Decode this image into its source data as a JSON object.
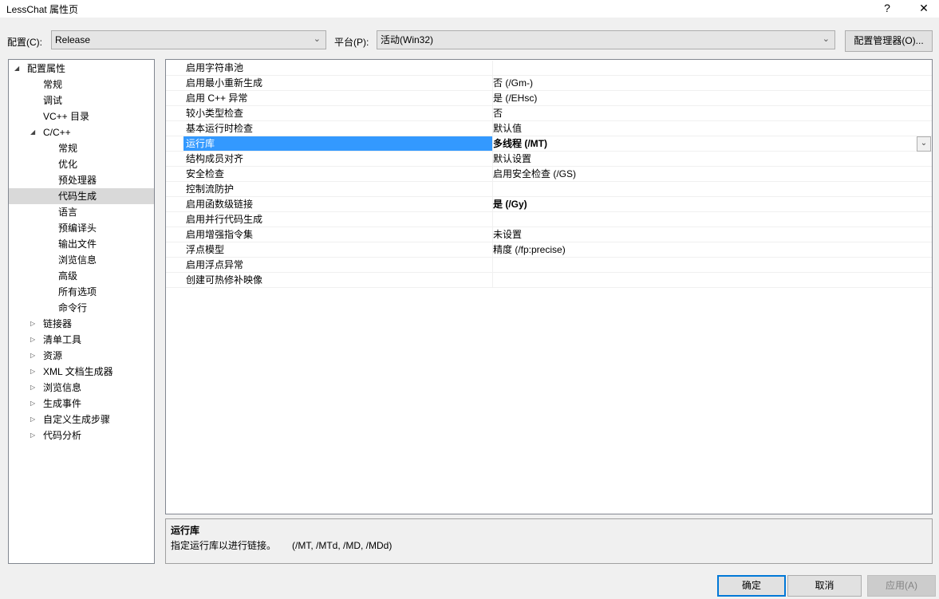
{
  "window": {
    "title": "LessChat 属性页",
    "help": "?",
    "close": "✕"
  },
  "config": {
    "label": "配置(C):",
    "value": "Release",
    "platform_label": "平台(P):",
    "platform_value": "活动(Win32)",
    "manager_button": "配置管理器(O)..."
  },
  "tree": [
    {
      "label": "配置属性",
      "level": 0,
      "expander": "expanded"
    },
    {
      "label": "常规",
      "level": 1
    },
    {
      "label": "调试",
      "level": 1
    },
    {
      "label": "VC++ 目录",
      "level": 1
    },
    {
      "label": "C/C++",
      "level": 1,
      "expander": "expanded"
    },
    {
      "label": "常规",
      "level": 2
    },
    {
      "label": "优化",
      "level": 2
    },
    {
      "label": "预处理器",
      "level": 2
    },
    {
      "label": "代码生成",
      "level": 2,
      "selected": true
    },
    {
      "label": "语言",
      "level": 2
    },
    {
      "label": "预编译头",
      "level": 2
    },
    {
      "label": "输出文件",
      "level": 2
    },
    {
      "label": "浏览信息",
      "level": 2
    },
    {
      "label": "高级",
      "level": 2
    },
    {
      "label": "所有选项",
      "level": 2
    },
    {
      "label": "命令行",
      "level": 2
    },
    {
      "label": "链接器",
      "level": 1,
      "expander": "collapsed"
    },
    {
      "label": "清单工具",
      "level": 1,
      "expander": "collapsed"
    },
    {
      "label": "资源",
      "level": 1,
      "expander": "collapsed"
    },
    {
      "label": "XML 文档生成器",
      "level": 1,
      "expander": "collapsed"
    },
    {
      "label": "浏览信息",
      "level": 1,
      "expander": "collapsed"
    },
    {
      "label": "生成事件",
      "level": 1,
      "expander": "collapsed"
    },
    {
      "label": "自定义生成步骤",
      "level": 1,
      "expander": "collapsed"
    },
    {
      "label": "代码分析",
      "level": 1,
      "expander": "collapsed"
    }
  ],
  "properties": [
    {
      "name": "启用字符串池",
      "value": ""
    },
    {
      "name": "启用最小重新生成",
      "value": "否 (/Gm-)"
    },
    {
      "name": "启用 C++ 异常",
      "value": "是 (/EHsc)"
    },
    {
      "name": "较小类型检查",
      "value": "否"
    },
    {
      "name": "基本运行时检查",
      "value": "默认值"
    },
    {
      "name": "运行库",
      "value": "多线程 (/MT)",
      "bold": true,
      "selected": true
    },
    {
      "name": "结构成员对齐",
      "value": "默认设置"
    },
    {
      "name": "安全检查",
      "value": "启用安全检查 (/GS)"
    },
    {
      "name": "控制流防护",
      "value": ""
    },
    {
      "name": "启用函数级链接",
      "value": "是 (/Gy)",
      "bold": true
    },
    {
      "name": "启用并行代码生成",
      "value": ""
    },
    {
      "name": "启用增强指令集",
      "value": "未设置"
    },
    {
      "name": "浮点模型",
      "value": "精度 (/fp:precise)"
    },
    {
      "name": "启用浮点异常",
      "value": ""
    },
    {
      "name": "创建可热修补映像",
      "value": ""
    }
  ],
  "description": {
    "title": "运行库",
    "text": "指定运行库以进行链接。      (/MT, /MTd, /MD, /MDd)"
  },
  "buttons": {
    "ok": "确定",
    "cancel": "取消",
    "apply": "应用(A)"
  },
  "colors": {
    "selection": "#3399ff",
    "tree_selection": "#d9d9d9",
    "ok_border": "#0078d7"
  }
}
